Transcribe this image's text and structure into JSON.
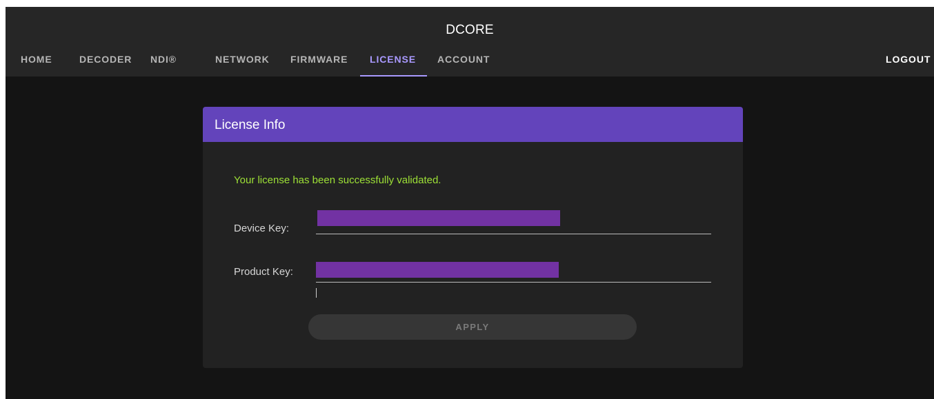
{
  "app": {
    "title": "DCORE"
  },
  "nav": {
    "tabs": [
      {
        "label": "HOME",
        "active": false
      },
      {
        "label": "DECODER",
        "active": false
      },
      {
        "label": "NDI®",
        "active": false
      },
      {
        "label": "NETWORK",
        "active": false
      },
      {
        "label": "FIRMWARE",
        "active": false
      },
      {
        "label": "LICENSE",
        "active": true
      },
      {
        "label": "ACCOUNT",
        "active": false
      }
    ],
    "logout_label": "LOGOUT"
  },
  "license_card": {
    "title": "License Info",
    "status_message": "Your license has been successfully validated.",
    "device_key_label": "Device Key:",
    "device_key_value": "",
    "product_key_label": "Product Key:",
    "product_key_value": "",
    "apply_label": "APPLY",
    "apply_enabled": false
  },
  "colors": {
    "accent": "#6344bb",
    "active_tab": "#a999ff",
    "success_text": "#9de036",
    "redaction": "#7232a3",
    "background": "#141414",
    "header_bar": "#262626",
    "card": "#222222"
  }
}
